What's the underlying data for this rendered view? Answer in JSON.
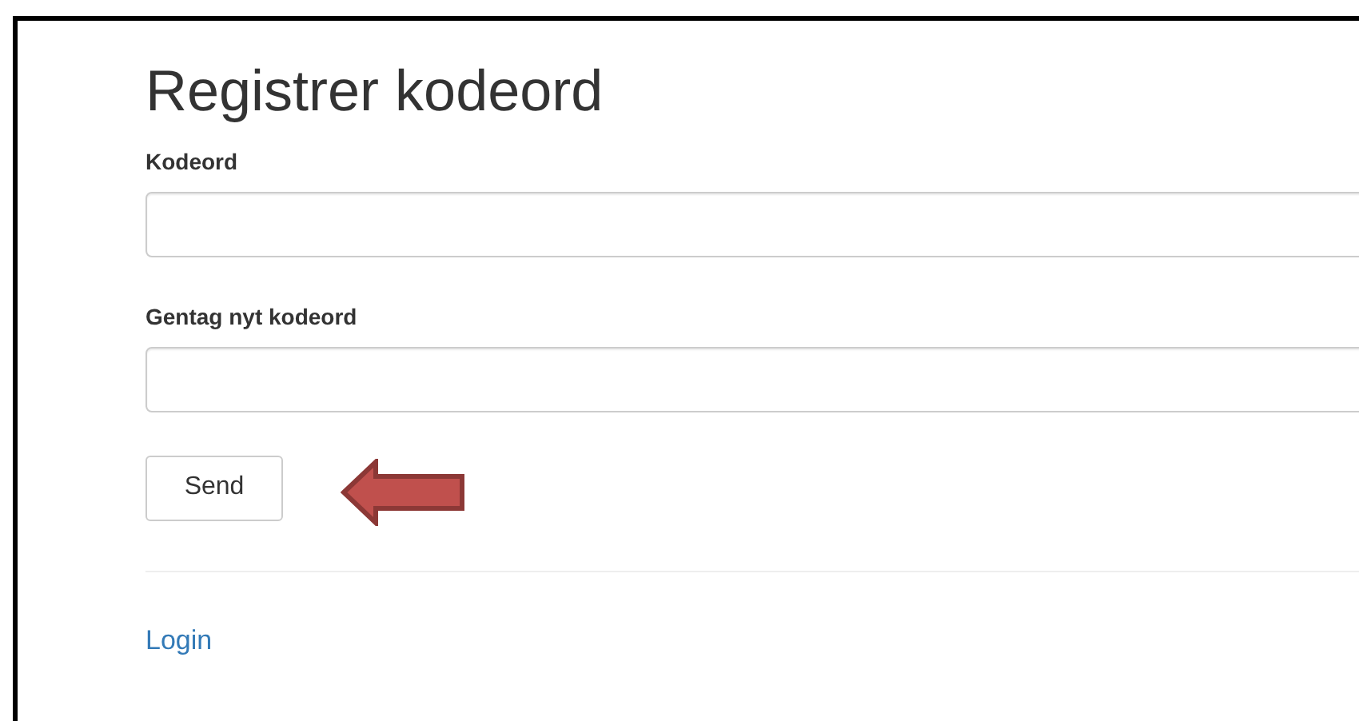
{
  "title": "Registrer kodeord",
  "fields": [
    {
      "label": "Kodeord"
    },
    {
      "label": "Gentag nyt kodeord"
    }
  ],
  "submit_button": "Send",
  "login_link": "Login"
}
